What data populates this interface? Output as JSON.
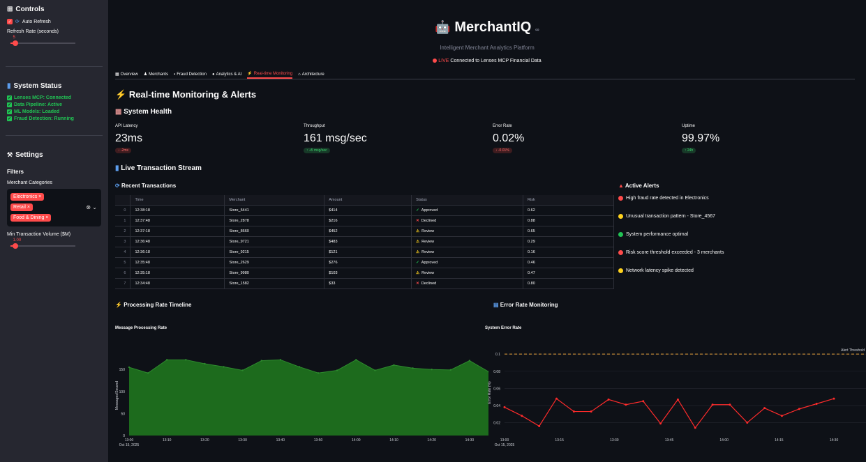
{
  "sidebar": {
    "controls_heading": "Controls",
    "auto_refresh_label": "Auto Refresh",
    "refresh_rate_label": "Refresh Rate (seconds)",
    "refresh_rate_value": "5",
    "refresh_rate_fraction": 0.07,
    "system_status_heading": "System Status",
    "status_items": [
      "Lenses MCP: Connected",
      "Data Pipeline: Active",
      "ML Models: Loaded",
      "Fraud Detection: Running"
    ],
    "settings_heading": "Settings",
    "filters_heading": "Filters",
    "merchant_categories_label": "Merchant Categories",
    "categories": [
      "Electronics",
      "Retail",
      "Food & Dining"
    ],
    "min_volume_label": "Min Transaction Volume ($M)",
    "min_volume_value": "1.00",
    "min_volume_fraction": 0.07
  },
  "header": {
    "title": "MerchantIQ",
    "subtitle": "Intelligent Merchant Analytics Platform",
    "live_word": "LIVE",
    "live_text": "Connected to Lenses MCP Financial Data"
  },
  "tabs": [
    {
      "icon": "▦",
      "label": "Overview"
    },
    {
      "icon": "♟",
      "label": "Merchants"
    },
    {
      "icon": "▪",
      "label": "Fraud Detection"
    },
    {
      "icon": "●",
      "label": "Analytics & AI"
    },
    {
      "icon": "⚡",
      "label": "Real-time Monitoring"
    },
    {
      "icon": "⌂",
      "label": "Architecture"
    }
  ],
  "active_tab": 4,
  "page": {
    "title": "Real-time Monitoring & Alerts",
    "system_health": "System Health",
    "live_stream": "Live Transaction Stream",
    "recent_txn": "Recent Transactions",
    "active_alerts": "Active Alerts",
    "processing_timeline": "Processing Rate Timeline",
    "error_monitoring": "Error Rate Monitoring"
  },
  "metrics": [
    {
      "label": "API Latency",
      "value": "23ms",
      "delta": "↓ -2ms",
      "tone": "red"
    },
    {
      "label": "Throughput",
      "value": "161 msg/sec",
      "delta": "↑ +5 msg/sec",
      "tone": "green"
    },
    {
      "label": "Error Rate",
      "value": "0.02%",
      "delta": "↓ -0.01%",
      "tone": "red"
    },
    {
      "label": "Uptime",
      "value": "99.97%",
      "delta": "↑ 24h",
      "tone": "green"
    }
  ],
  "transactions": {
    "columns": [
      "",
      "Time",
      "Merchant",
      "Amount",
      "Status",
      "Risk"
    ],
    "rows": [
      [
        "0",
        "12:38:18",
        "Store_5441",
        "$414",
        "Approved",
        "0.62"
      ],
      [
        "1",
        "12:37:48",
        "Store_2878",
        "$216",
        "Declined",
        "0.88"
      ],
      [
        "2",
        "12:37:18",
        "Store_8660",
        "$452",
        "Review",
        "0.65"
      ],
      [
        "3",
        "12:36:48",
        "Store_9721",
        "$483",
        "Review",
        "0.29"
      ],
      [
        "4",
        "12:36:18",
        "Store_9215",
        "$121",
        "Review",
        "0.16"
      ],
      [
        "5",
        "12:35:48",
        "Store_2629",
        "$276",
        "Approved",
        "0.46"
      ],
      [
        "6",
        "12:35:18",
        "Store_9980",
        "$103",
        "Review",
        "0.47"
      ],
      [
        "7",
        "12:34:48",
        "Store_1582",
        "$33",
        "Declined",
        "0.80"
      ]
    ]
  },
  "alerts": [
    {
      "color": "#ff4b4b",
      "text": "High fraud rate detected in Electronics"
    },
    {
      "color": "#ffd21e",
      "text": "Unusual transaction pattern - Store_4567"
    },
    {
      "color": "#21c354",
      "text": "System performance optimal"
    },
    {
      "color": "#ff4b4b",
      "text": "Risk score threshold exceeded - 3 merchants"
    },
    {
      "color": "#ffd21e",
      "text": "Network latency spike detected"
    }
  ],
  "chart_data": [
    {
      "type": "area",
      "title": "Message Processing Rate",
      "ylabel": "Messages/Second",
      "xlabel": "",
      "x_ticks": [
        "13:00",
        "13:10",
        "13:20",
        "13:30",
        "13:40",
        "13:50",
        "14:00",
        "14:10",
        "14:20",
        "14:30"
      ],
      "x_date_label": "Oct 15, 2025",
      "y_ticks": [
        0,
        50,
        100,
        150
      ],
      "ylim": [
        0,
        182
      ],
      "xlim": [
        0,
        95
      ],
      "x": [
        0,
        5,
        10,
        15,
        20,
        25,
        30,
        35,
        40,
        45,
        50,
        55,
        60,
        65,
        70,
        75,
        80,
        85,
        90,
        95
      ],
      "values": [
        155,
        142,
        172,
        172,
        163,
        156,
        148,
        170,
        172,
        156,
        142,
        148,
        172,
        148,
        160,
        153,
        150,
        149,
        170,
        145
      ],
      "color": "#1d6b1d",
      "line_color": "#2e8b2e"
    },
    {
      "type": "line",
      "title": "System Error Rate",
      "ylabel": "Error Rate (%)",
      "xlabel": "",
      "x_ticks": [
        "13:00",
        "13:15",
        "13:30",
        "13:45",
        "14:00",
        "14:15",
        "14:30"
      ],
      "x_date_label": "Oct 15, 2025",
      "y_ticks": [
        0.02,
        0.04,
        0.06,
        0.08,
        0.1
      ],
      "ylim": [
        0.005,
        0.105
      ],
      "xlim": [
        0,
        95
      ],
      "x": [
        0,
        5,
        10,
        15,
        20,
        25,
        30,
        35,
        40,
        45,
        50,
        55,
        60,
        65,
        70,
        75,
        80,
        85,
        90,
        95
      ],
      "values": [
        0.038,
        0.028,
        0.016,
        0.048,
        0.033,
        0.033,
        0.047,
        0.041,
        0.045,
        0.019,
        0.047,
        0.014,
        0.041,
        0.041,
        0.02,
        0.037,
        0.028,
        0.036,
        0.042,
        0.048
      ],
      "threshold": 0.1,
      "threshold_label": "Alert Threshold",
      "color": "#ff2b2b"
    }
  ]
}
